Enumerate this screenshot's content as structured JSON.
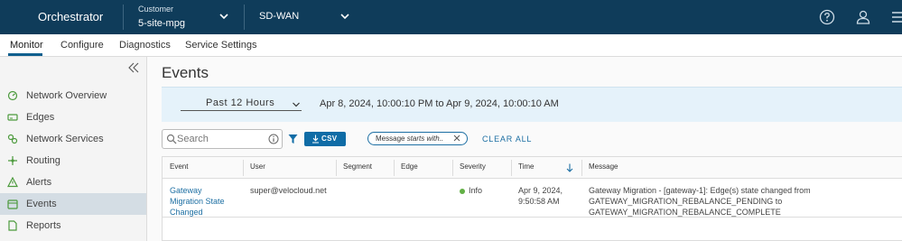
{
  "header": {
    "brand": "Orchestrator",
    "customer_label": "Customer",
    "customer_value": "5-site-mpg",
    "network_value": "SD-WAN",
    "icons": [
      "help-icon",
      "user-icon",
      "menu-icon"
    ]
  },
  "tabs": [
    {
      "label": "Monitor",
      "active": true
    },
    {
      "label": "Configure",
      "active": false
    },
    {
      "label": "Diagnostics",
      "active": false
    },
    {
      "label": "Service Settings",
      "active": false
    }
  ],
  "sidebar": {
    "items": [
      {
        "label": "Network Overview",
        "icon": "network-overview-icon",
        "active": false
      },
      {
        "label": "Edges",
        "icon": "edges-icon",
        "active": false
      },
      {
        "label": "Network Services",
        "icon": "network-services-icon",
        "active": false
      },
      {
        "label": "Routing",
        "icon": "routing-icon",
        "active": false
      },
      {
        "label": "Alerts",
        "icon": "alerts-icon",
        "active": false
      },
      {
        "label": "Events",
        "icon": "events-icon",
        "active": true
      },
      {
        "label": "Reports",
        "icon": "reports-icon",
        "active": false
      }
    ]
  },
  "main": {
    "title": "Events",
    "time_range": "Past 12 Hours",
    "date_range": "Apr 8, 2024, 10:00:10 PM to Apr 9, 2024, 10:00:10 AM",
    "search_placeholder": "Search",
    "csv_label": "CSV",
    "filter_chip_prefix": "Message",
    "filter_chip_operator": "starts with..",
    "clear_all": "CLEAR ALL"
  },
  "table": {
    "columns": [
      "Event",
      "User",
      "Segment",
      "Edge",
      "Severity",
      "Time",
      "Message"
    ],
    "sort_column": "Time",
    "rows": [
      {
        "event": [
          "Gateway",
          "Migration State",
          "Changed"
        ],
        "user": "super@velocloud.net",
        "segment": "",
        "edge": "",
        "severity": "Info",
        "time": [
          "Apr 9, 2024,",
          "9:50:58 AM"
        ],
        "message": [
          "Gateway Migration - [gateway-1]: Edge(s) state changed from",
          "GATEWAY_MIGRATION_REBALANCE_PENDING to",
          "GATEWAY_MIGRATION_REBALANCE_COMPLETE"
        ]
      }
    ]
  },
  "colors": {
    "header_bg": "#0f3c5a",
    "accent": "#0f6ca6",
    "link": "#1d6fa3",
    "info_dot": "#62b045",
    "filter_band": "#e5f2fa"
  }
}
